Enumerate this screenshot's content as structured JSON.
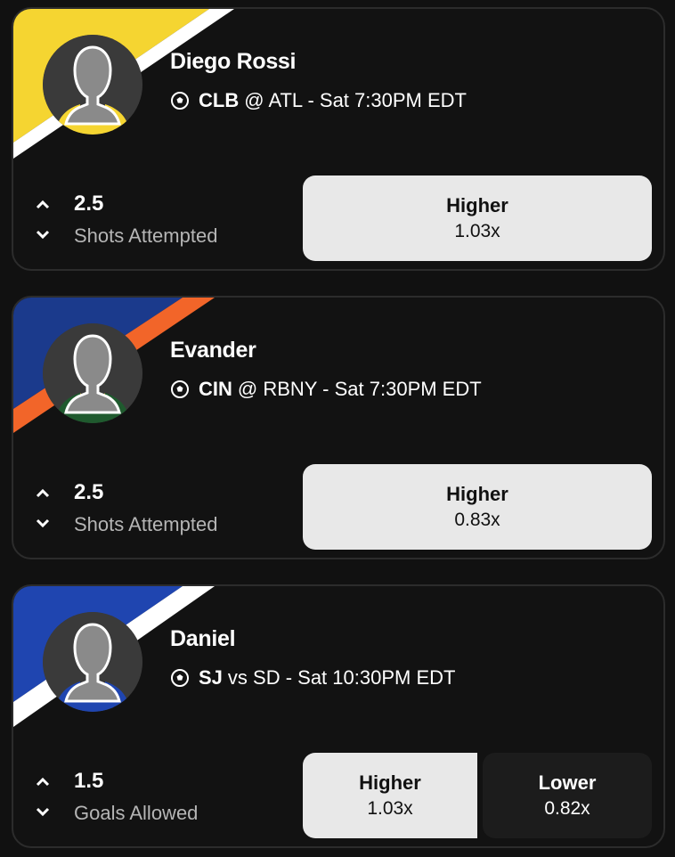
{
  "cards": [
    {
      "player": "Diego Rossi",
      "team": "CLB",
      "matchup_rest": "@ ATL - Sat 7:30PM EDT",
      "line": "2.5",
      "stat": "Shots Attempted",
      "colors": {
        "primary": "#f5d531",
        "stripe": "#ffffff",
        "jersey": "#f5d531",
        "collar": "#111111"
      },
      "options": [
        {
          "label": "Higher",
          "multiplier": "1.03x"
        }
      ]
    },
    {
      "player": "Evander",
      "team": "CIN",
      "matchup_rest": "@ RBNY - Sat 7:30PM EDT",
      "line": "2.5",
      "stat": "Shots Attempted",
      "colors": {
        "primary": "#1b3a8c",
        "stripe": "#f26529",
        "jersey": "#1f5a2e",
        "collar": "#c9a227"
      },
      "options": [
        {
          "label": "Higher",
          "multiplier": "0.83x"
        }
      ]
    },
    {
      "player": "Daniel",
      "team": "SJ",
      "matchup_rest": "vs SD - Sat 10:30PM EDT",
      "line": "1.5",
      "stat": "Goals Allowed",
      "colors": {
        "primary": "#1f45b0",
        "stripe": "#ffffff",
        "jersey": "#1f45b0",
        "collar": "#111111"
      },
      "options": [
        {
          "label": "Higher",
          "multiplier": "1.03x"
        },
        {
          "label": "Lower",
          "multiplier": "0.82x"
        }
      ]
    }
  ],
  "icons": {
    "sport": "soccer-ball-icon",
    "up": "chevron-up-icon",
    "down": "chevron-down-icon",
    "avatar": "player-silhouette-icon"
  }
}
